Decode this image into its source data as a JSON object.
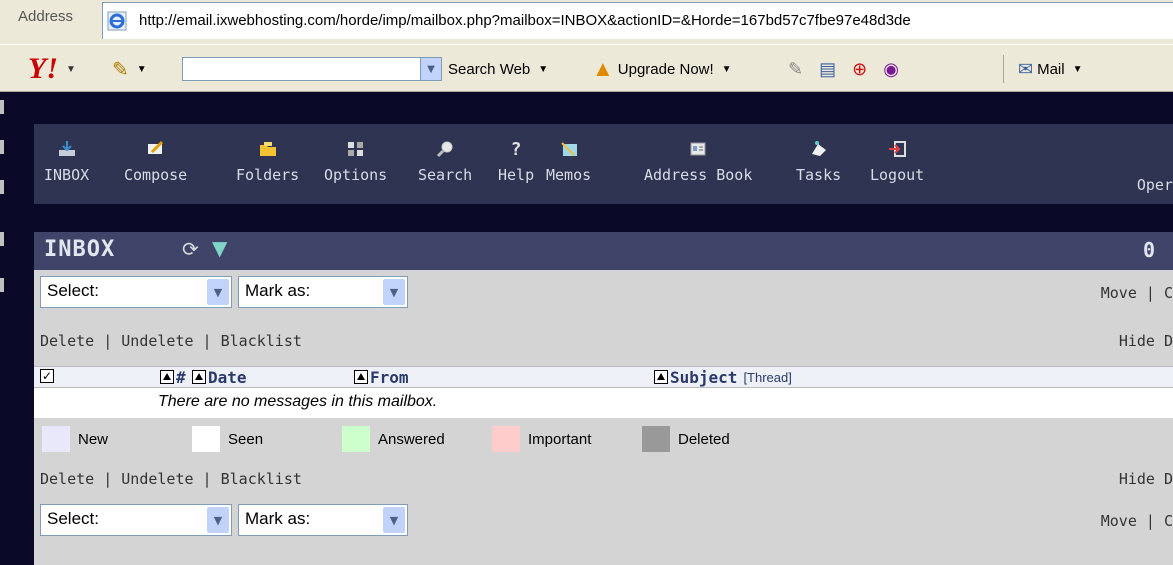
{
  "browser": {
    "address_label": "Address",
    "url": "http://email.ixwebhosting.com/horde/imp/mailbox.php?mailbox=INBOX&actionID=&Horde=167bd57c7fbe97e48d3de",
    "toolbar": {
      "search_web": "Search Web",
      "upgrade_now": "Upgrade Now!",
      "mail": "Mail"
    }
  },
  "nav": {
    "items": [
      {
        "label": "INBOX",
        "icon": "inbox-icon"
      },
      {
        "label": "Compose",
        "icon": "compose-icon"
      },
      {
        "label": "Folders",
        "icon": "folders-icon"
      },
      {
        "label": "Options",
        "icon": "options-icon"
      },
      {
        "label": "Search",
        "icon": "search-icon"
      },
      {
        "label": "Help",
        "icon": "help-icon"
      },
      {
        "label": "Memos",
        "icon": "memos-icon"
      },
      {
        "label": "Address Book",
        "icon": "address-book-icon"
      },
      {
        "label": "Tasks",
        "icon": "tasks-icon"
      },
      {
        "label": "Logout",
        "icon": "logout-icon"
      }
    ],
    "open_cut": "Oper"
  },
  "mailbox": {
    "title": "INBOX",
    "count": "0",
    "select_label": "Select:",
    "mark_as_label": "Mark as:",
    "move_copy": "Move | C",
    "actions": {
      "delete": "Delete",
      "undelete": "Undelete",
      "blacklist": "Blacklist",
      "sep": " | "
    },
    "hide_cut": "Hide D",
    "columns": {
      "num": "#",
      "date": "Date",
      "from": "From",
      "subject": "Subject",
      "thread": "[Thread]"
    },
    "empty_message": "There are no messages in this mailbox.",
    "legend": [
      {
        "label": "New",
        "color": "#e8e8fa"
      },
      {
        "label": "Seen",
        "color": "#ffffff"
      },
      {
        "label": "Answered",
        "color": "#ccffcc"
      },
      {
        "label": "Important",
        "color": "#ffcccc"
      },
      {
        "label": "Deleted",
        "color": "#999999"
      }
    ]
  }
}
